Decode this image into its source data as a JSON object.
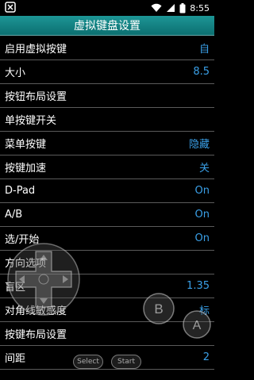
{
  "status": {
    "time": "8:55"
  },
  "title": "虚拟键盘设置",
  "rows": [
    {
      "label": "启用虚拟按键",
      "value": "自"
    },
    {
      "label": "大小",
      "value": "8.5"
    },
    {
      "label": "按钮布局设置",
      "value": ""
    },
    {
      "label": "单按键开关",
      "value": ""
    },
    {
      "label": "菜单按键",
      "value": "隐藏"
    },
    {
      "label": "按键加速",
      "value": "关"
    },
    {
      "label": "D-Pad",
      "value": "On"
    },
    {
      "label": "A/B",
      "value": "On"
    },
    {
      "label": "选/开始",
      "value": "On"
    },
    {
      "label": "方向选项",
      "value": ""
    },
    {
      "label": "盲区",
      "value": "1.35"
    },
    {
      "label": "对角线敏感度",
      "value": "标"
    },
    {
      "label": "按键布局设置",
      "value": ""
    },
    {
      "label": "间距",
      "value": "2"
    }
  ],
  "overlay": {
    "button_b": "B",
    "button_a": "A",
    "select_label": "Select",
    "start_label": "Start"
  }
}
